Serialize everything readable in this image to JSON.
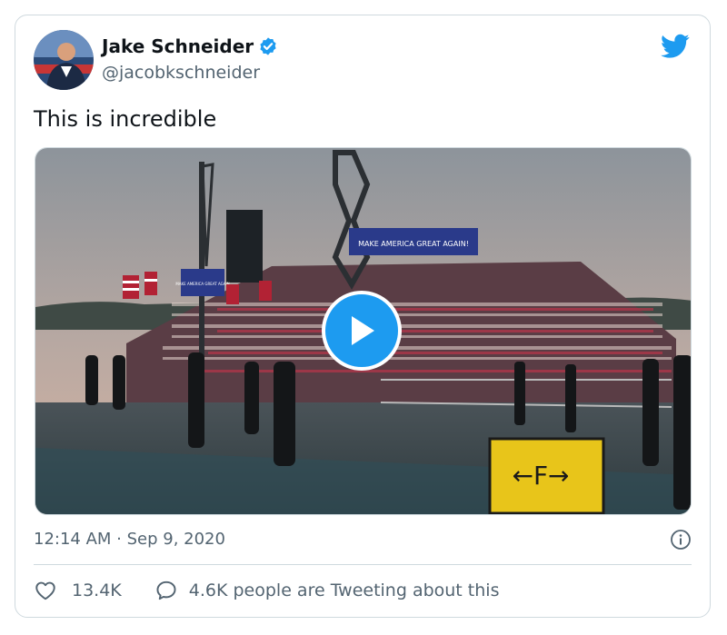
{
  "tweet": {
    "author_name": "Jake Schneider",
    "author_handle": "@jacobkschneider",
    "verified": true,
    "text": "This is incredible",
    "timestamp": "12:14 AM · Sep 9, 2020",
    "likes": "13.4K",
    "conversation": "4.6K people are Tweeting about this"
  },
  "media": {
    "type": "video",
    "banner_large": "MAKE AMERICA GREAT AGAIN!",
    "banner_small": "MAKE AMERICA GREAT AGAIN",
    "sign_text": "←F→"
  },
  "icons": {
    "verified": "verified-badge-icon",
    "brand": "twitter-bird-icon",
    "play": "play-icon",
    "info": "info-icon",
    "like": "heart-icon",
    "reply": "speech-bubble-icon"
  },
  "colors": {
    "brand_blue": "#1d9bf0",
    "text_primary": "#0f1419",
    "text_secondary": "#536471",
    "border": "#cfd9de"
  }
}
